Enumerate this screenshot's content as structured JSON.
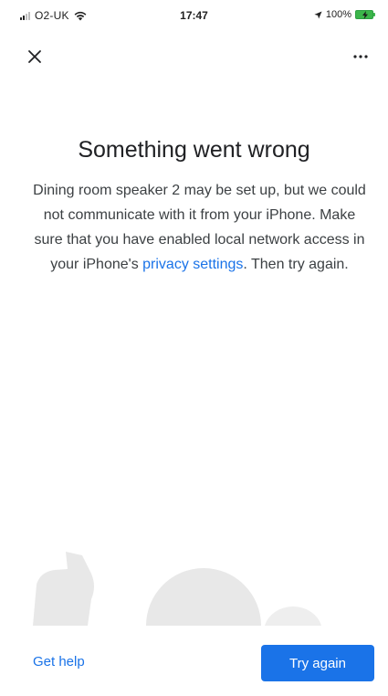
{
  "status_bar": {
    "carrier": "O2-UK",
    "time": "17:47",
    "battery": "100%"
  },
  "error": {
    "title": "Something went wrong",
    "message_before_link": "Dining room speaker 2 may be set up, but we could not communicate with it from your iPhone. Make sure that you have enabled local network access in your iPhone's ",
    "link_label": "privacy settings",
    "message_after_link": ". Then try again."
  },
  "actions": {
    "get_help_label": "Get help",
    "try_again_label": "Try again"
  },
  "colors": {
    "accent": "#1a73e8",
    "illustration": "#e8e8e8"
  }
}
